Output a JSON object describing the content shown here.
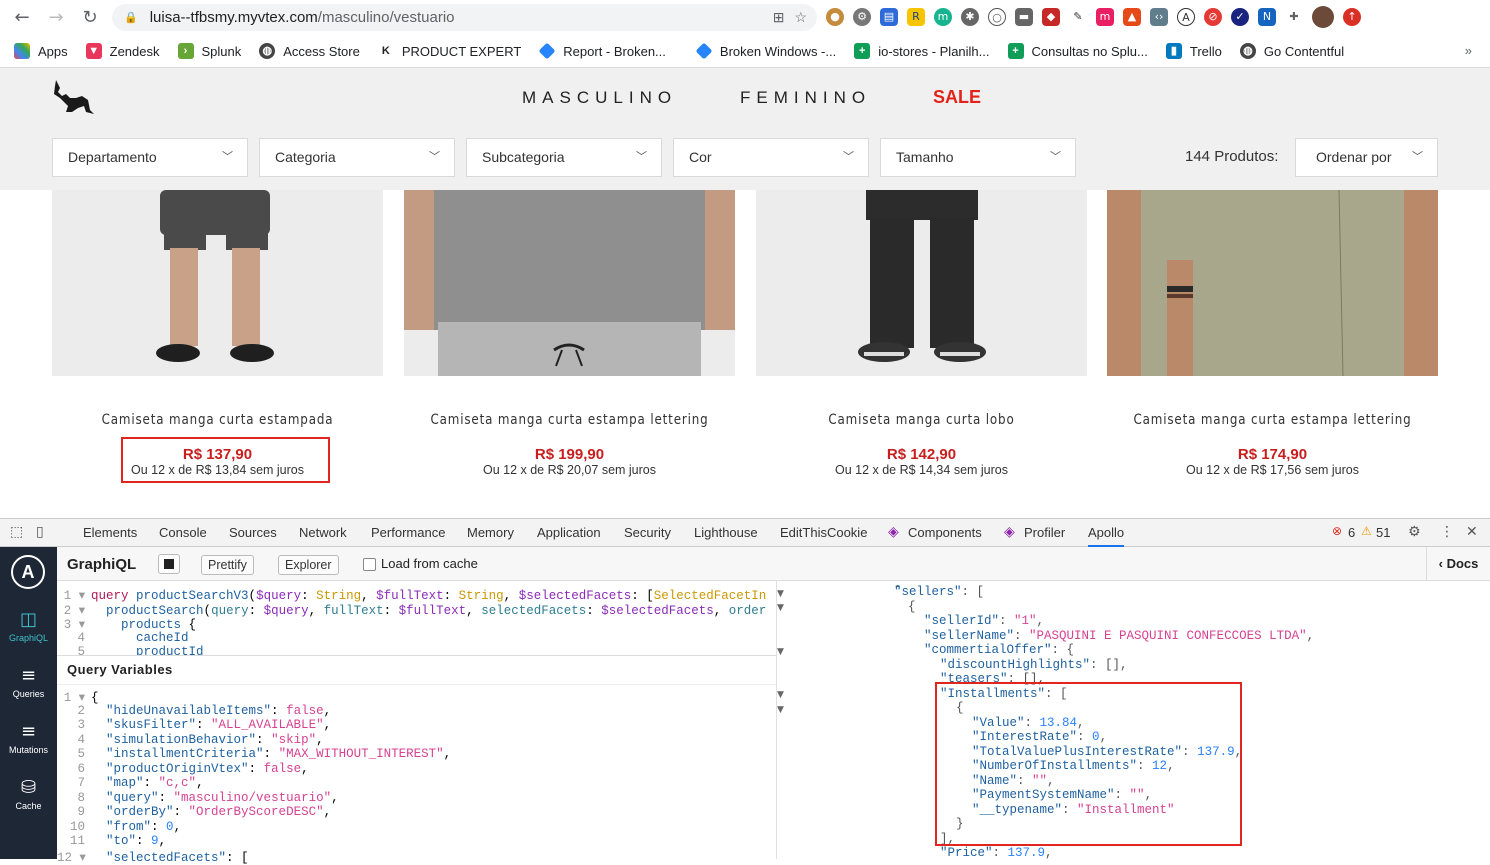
{
  "browser": {
    "url_host": "luisa--tfbsmy.myvtex.com",
    "url_path": "/masculino/vestuario",
    "bookmarks": [
      {
        "label": "Apps",
        "color": "#e8453c"
      },
      {
        "label": "Zendesk",
        "color": "#e8365d"
      },
      {
        "label": "Splunk",
        "color": "#65a637"
      },
      {
        "label": "Access Store",
        "color": "#444444"
      },
      {
        "label": "PRODUCT EXPERT",
        "color": "#222222"
      },
      {
        "label": "Report - Broken...",
        "color": "#2684ff"
      },
      {
        "label": "Broken Windows -...",
        "color": "#2684ff"
      },
      {
        "label": "io-stores - Planilh...",
        "color": "#0f9d58"
      },
      {
        "label": "Consultas no Splu...",
        "color": "#0f9d58"
      },
      {
        "label": "Trello",
        "color": "#0079bf"
      },
      {
        "label": "Go Contentful",
        "color": "#444444"
      }
    ],
    "more": "»"
  },
  "store": {
    "menu": {
      "masculino": "MASCULINO",
      "feminino": "FEMININO",
      "sale": "SALE"
    },
    "filters": [
      "Departamento",
      "Categoria",
      "Subcategoria",
      "Cor",
      "Tamanho"
    ],
    "product_count": "144 Produtos:",
    "sort_label": "Ordenar por",
    "products": [
      {
        "name": "Camiseta manga curta estampada",
        "price": "R$ 137,90",
        "installments": "Ou 12 x de R$ 13,84 sem juros"
      },
      {
        "name": "Camiseta manga curta estampa lettering",
        "price": "R$ 199,90",
        "installments": "Ou 12 x de R$ 20,07 sem juros"
      },
      {
        "name": "Camiseta manga curta lobo",
        "price": "R$ 142,90",
        "installments": "Ou 12 x de R$ 14,34 sem juros"
      },
      {
        "name": "Camiseta manga curta estampa lettering",
        "price": "R$ 174,90",
        "installments": "Ou 12 x de R$ 17,56 sem juros"
      }
    ]
  },
  "devtools": {
    "tabs": [
      "Elements",
      "Console",
      "Sources",
      "Network",
      "Performance",
      "Memory",
      "Application",
      "Security",
      "Lighthouse",
      "EditThisCookie",
      "Components",
      "Profiler",
      "Apollo"
    ],
    "errors": "6",
    "warnings": "51"
  },
  "apollo": {
    "nav": [
      "GraphiQL",
      "Queries",
      "Mutations",
      "Cache"
    ],
    "graphiql_title": "GraphiQL",
    "prettify": "Prettify",
    "explorer": "Explorer",
    "load_from_cache": "Load from cache",
    "docs": "Docs",
    "query_variables_title": "Query Variables"
  },
  "colors": {
    "accent": "#e0261f",
    "sale": "#e32219",
    "price": "#c81e1e",
    "apollo_sidebar": "#1e2736"
  }
}
